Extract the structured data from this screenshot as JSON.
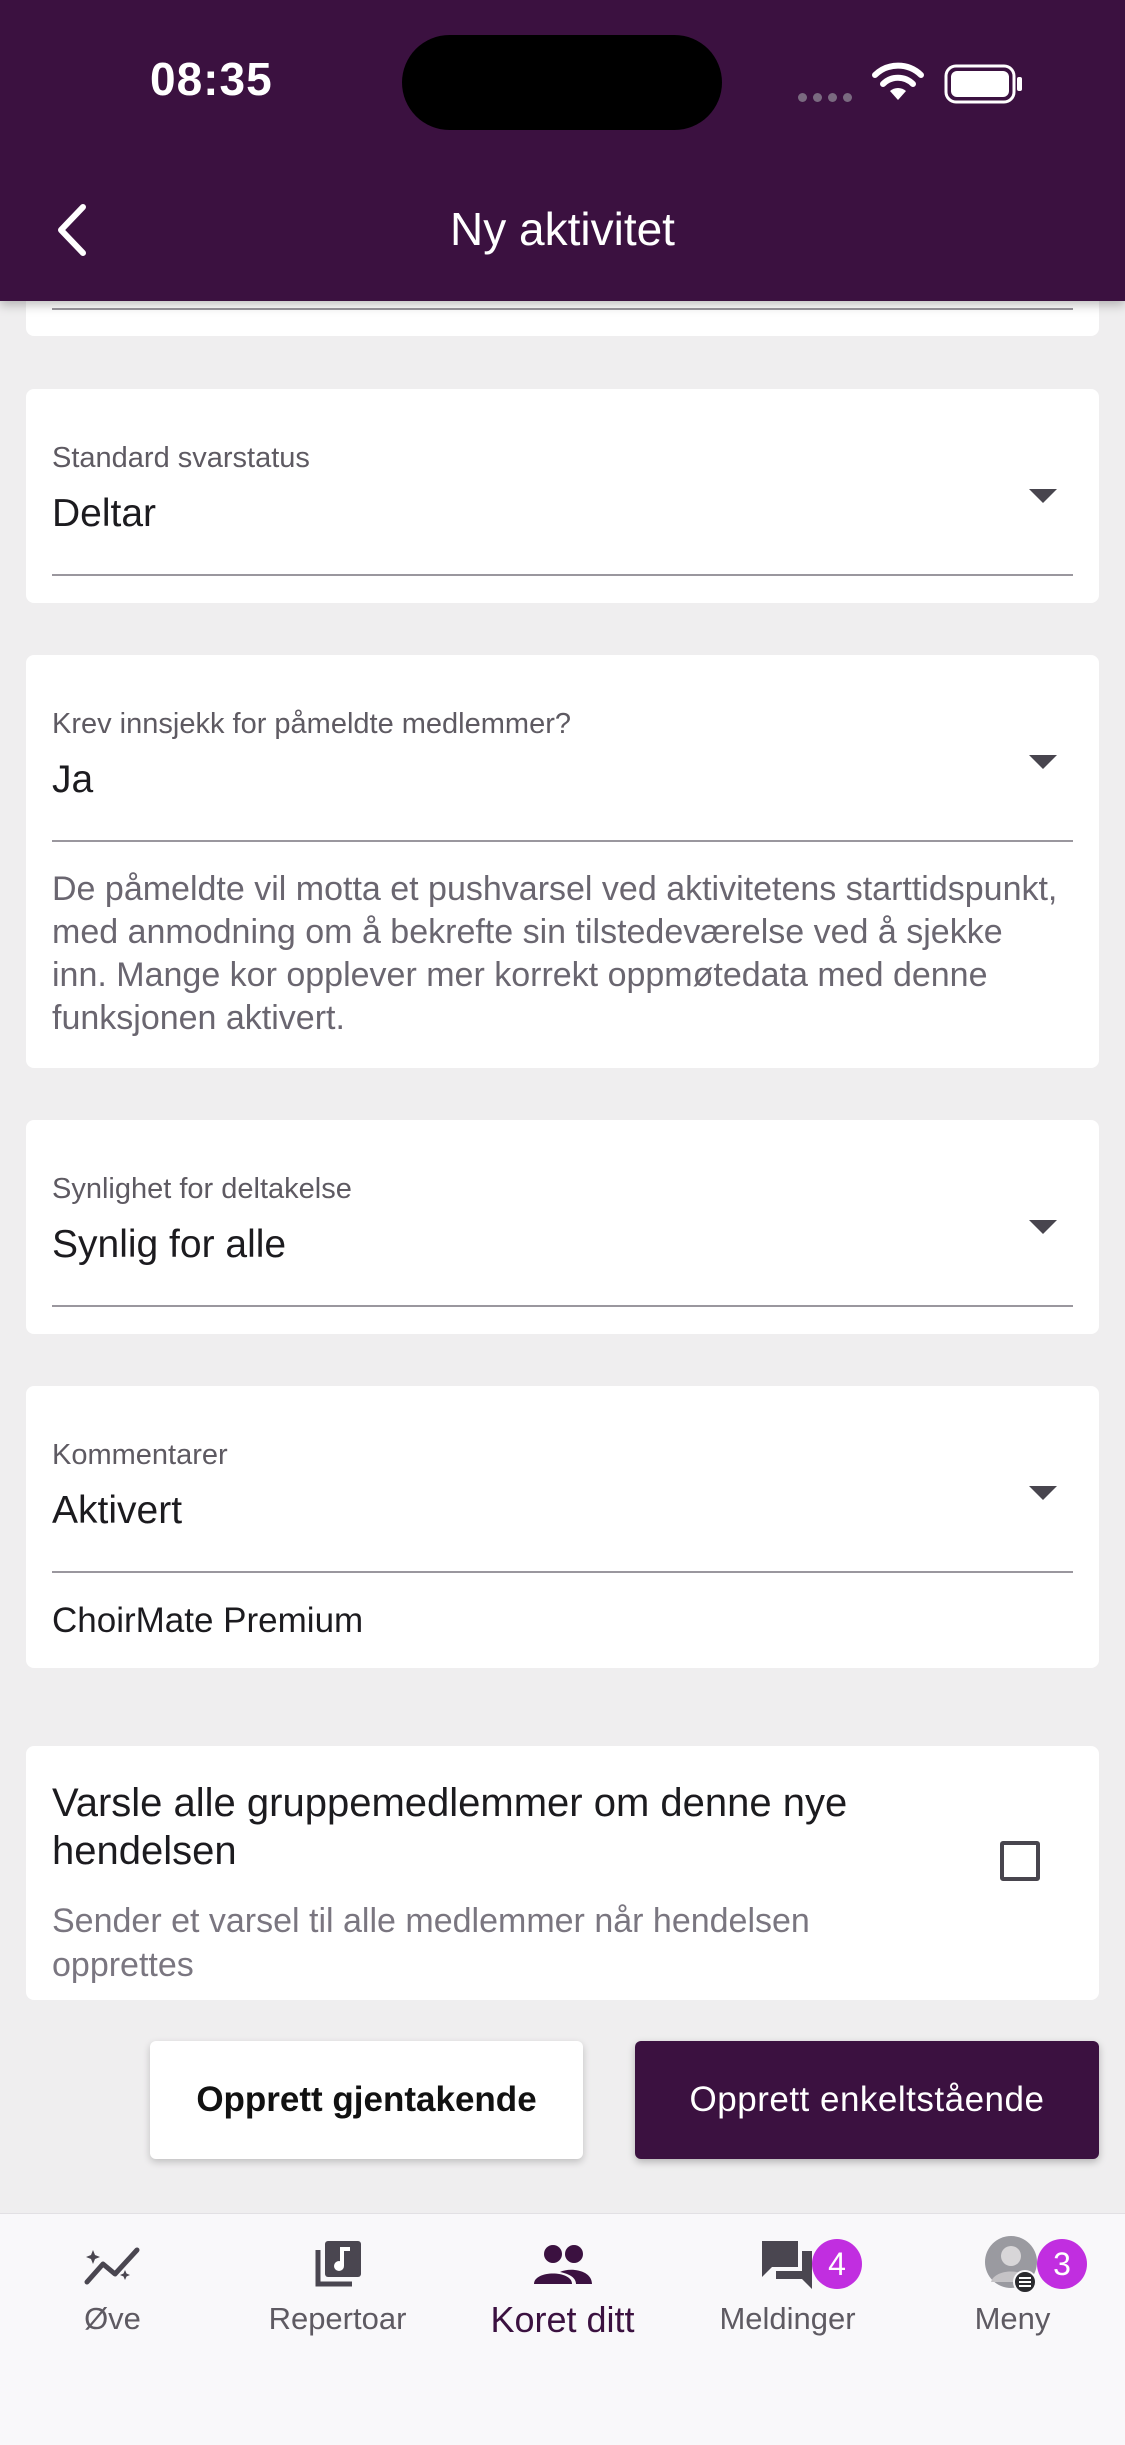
{
  "status": {
    "time": "08:35"
  },
  "header": {
    "title": "Ny aktivitet"
  },
  "fields": {
    "response_status": {
      "label": "Standard svarstatus",
      "value": "Deltar"
    },
    "checkin": {
      "label": "Krev innsjekk for påmeldte medlemmer?",
      "value": "Ja",
      "helper": "De påmeldte vil motta et pushvarsel ved aktivitetens starttidspunkt, med anmodning om å bekrefte sin tilstedeværelse ved å sjekke inn. Mange kor opplever mer korrekt oppmøtedata med denne funksjonen aktivert."
    },
    "visibility": {
      "label": "Synlighet for deltakelse",
      "value": "Synlig for alle"
    },
    "comments": {
      "label": "Kommentarer",
      "value": "Aktivert",
      "note": "ChoirMate Premium"
    }
  },
  "notify": {
    "title": "Varsle alle gruppemedlemmer om denne nye hendelsen",
    "subtitle": "Sender et varsel til alle medlemmer når hendelsen opprettes",
    "checked": false
  },
  "actions": {
    "recurring_label": "Opprett gjentakende",
    "single_label": "Opprett enkeltstående"
  },
  "nav": {
    "items": [
      {
        "label": "Øve",
        "icon": "trend-icon"
      },
      {
        "label": "Repertoar",
        "icon": "music-library-icon"
      },
      {
        "label": "Koret ditt",
        "icon": "group-icon",
        "active": true
      },
      {
        "label": "Meldinger",
        "icon": "chat-icon",
        "badge": "4"
      },
      {
        "label": "Meny",
        "icon": "avatar",
        "badge": "3"
      }
    ]
  },
  "colors": {
    "brand": "#3b1140",
    "badge": "#c12ee0"
  }
}
